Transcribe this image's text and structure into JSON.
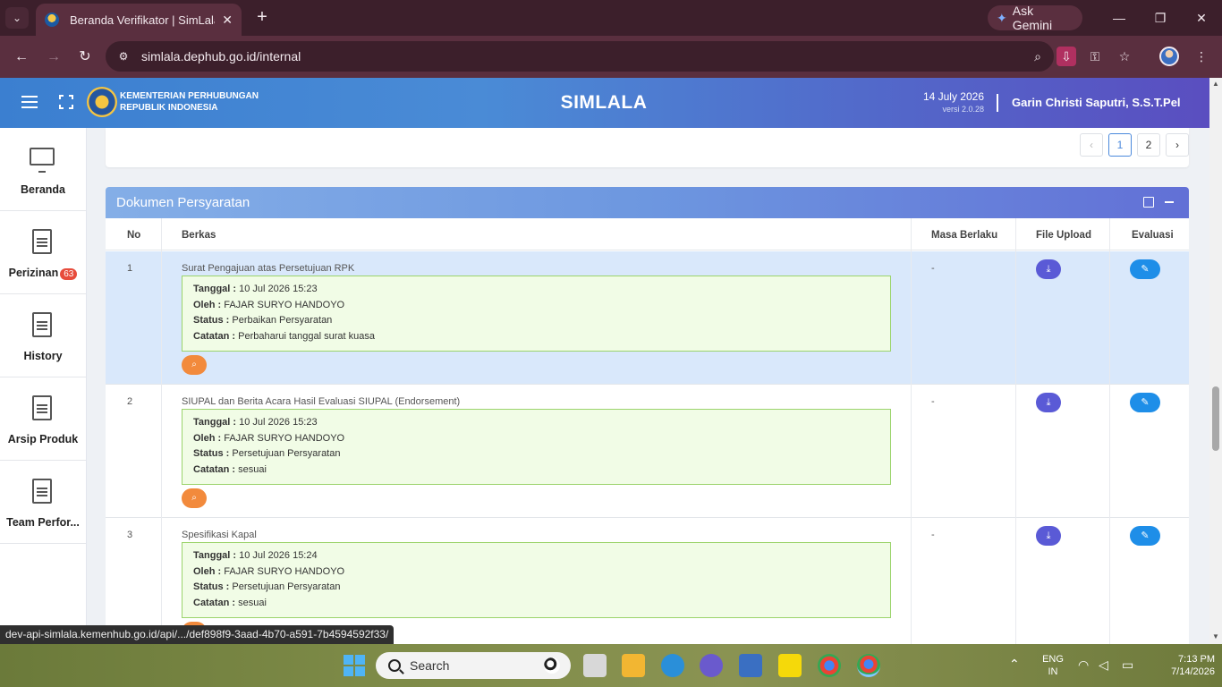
{
  "browser": {
    "tab_title": "Beranda Verifikator | SimLala",
    "url": "simlala.dephub.go.id/internal",
    "gemini_label": "Ask Gemini"
  },
  "header": {
    "ministry_line1": "KEMENTERIAN PERHUBUNGAN",
    "ministry_line2": "REPUBLIK INDONESIA",
    "app_title": "SIMLALA",
    "date": "14 July 2026",
    "version": "versi 2.0.28",
    "user_name": "Garin Christi Saputri, S.S.T.Pel"
  },
  "sidebar": {
    "items": [
      {
        "label": "Beranda"
      },
      {
        "label": "Perizinan",
        "badge": "63"
      },
      {
        "label": "History"
      },
      {
        "label": "Arsip Produk"
      },
      {
        "label": "Team Perfor..."
      }
    ]
  },
  "pagination": {
    "prev": "‹",
    "pages": [
      "1",
      "2"
    ],
    "next": "›",
    "current": "1"
  },
  "card": {
    "title": "Dokumen Persyaratan",
    "columns": {
      "no": "No",
      "berkas": "Berkas",
      "masa": "Masa Berlaku",
      "upload": "File Upload",
      "evaluasi": "Evaluasi"
    },
    "labels": {
      "tanggal": "Tanggal :",
      "oleh": "Oleh :",
      "status": "Status :",
      "catatan": "Catatan :"
    },
    "rows": [
      {
        "no": "1",
        "berkas": "Surat Pengajuan atas Persetujuan RPK",
        "tanggal": "10 Jul 2026 15:23",
        "oleh": "FAJAR SURYO HANDOYO",
        "status": "Perbaikan Persyaratan",
        "catatan": "Perbaharui tanggal surat kuasa",
        "masa": "-"
      },
      {
        "no": "2",
        "berkas": "SIUPAL dan Berita Acara Hasil Evaluasi SIUPAL (Endorsement)",
        "tanggal": "10 Jul 2026 15:23",
        "oleh": "FAJAR SURYO HANDOYO",
        "status": "Persetujuan Persyaratan",
        "catatan": "sesuai",
        "masa": "-"
      },
      {
        "no": "3",
        "berkas": "Spesifikasi Kapal",
        "tanggal": "10 Jul 2026 15:24",
        "oleh": "FAJAR SURYO HANDOYO",
        "status": "Persetujuan Persyaratan",
        "catatan": "sesuai",
        "masa": "-"
      }
    ]
  },
  "status_url": "dev-api-simlala.kemenhub.go.id/api/.../def898f9-3aad-4b70-a591-7b4594592f33/",
  "taskbar": {
    "search_placeholder": "Search",
    "lang1": "ENG",
    "lang2": "IN",
    "time": "7:13 PM",
    "date": "7/14/2026"
  },
  "colors": {
    "header_start": "#3b7fd0",
    "header_end": "#5a4ec0",
    "highlight_row": "#d9e8fb",
    "info_box": "#f1fce6",
    "download_btn": "#5a5ad6",
    "edit_btn": "#1e8ee8",
    "zoom_btn": "#f28a3c"
  }
}
